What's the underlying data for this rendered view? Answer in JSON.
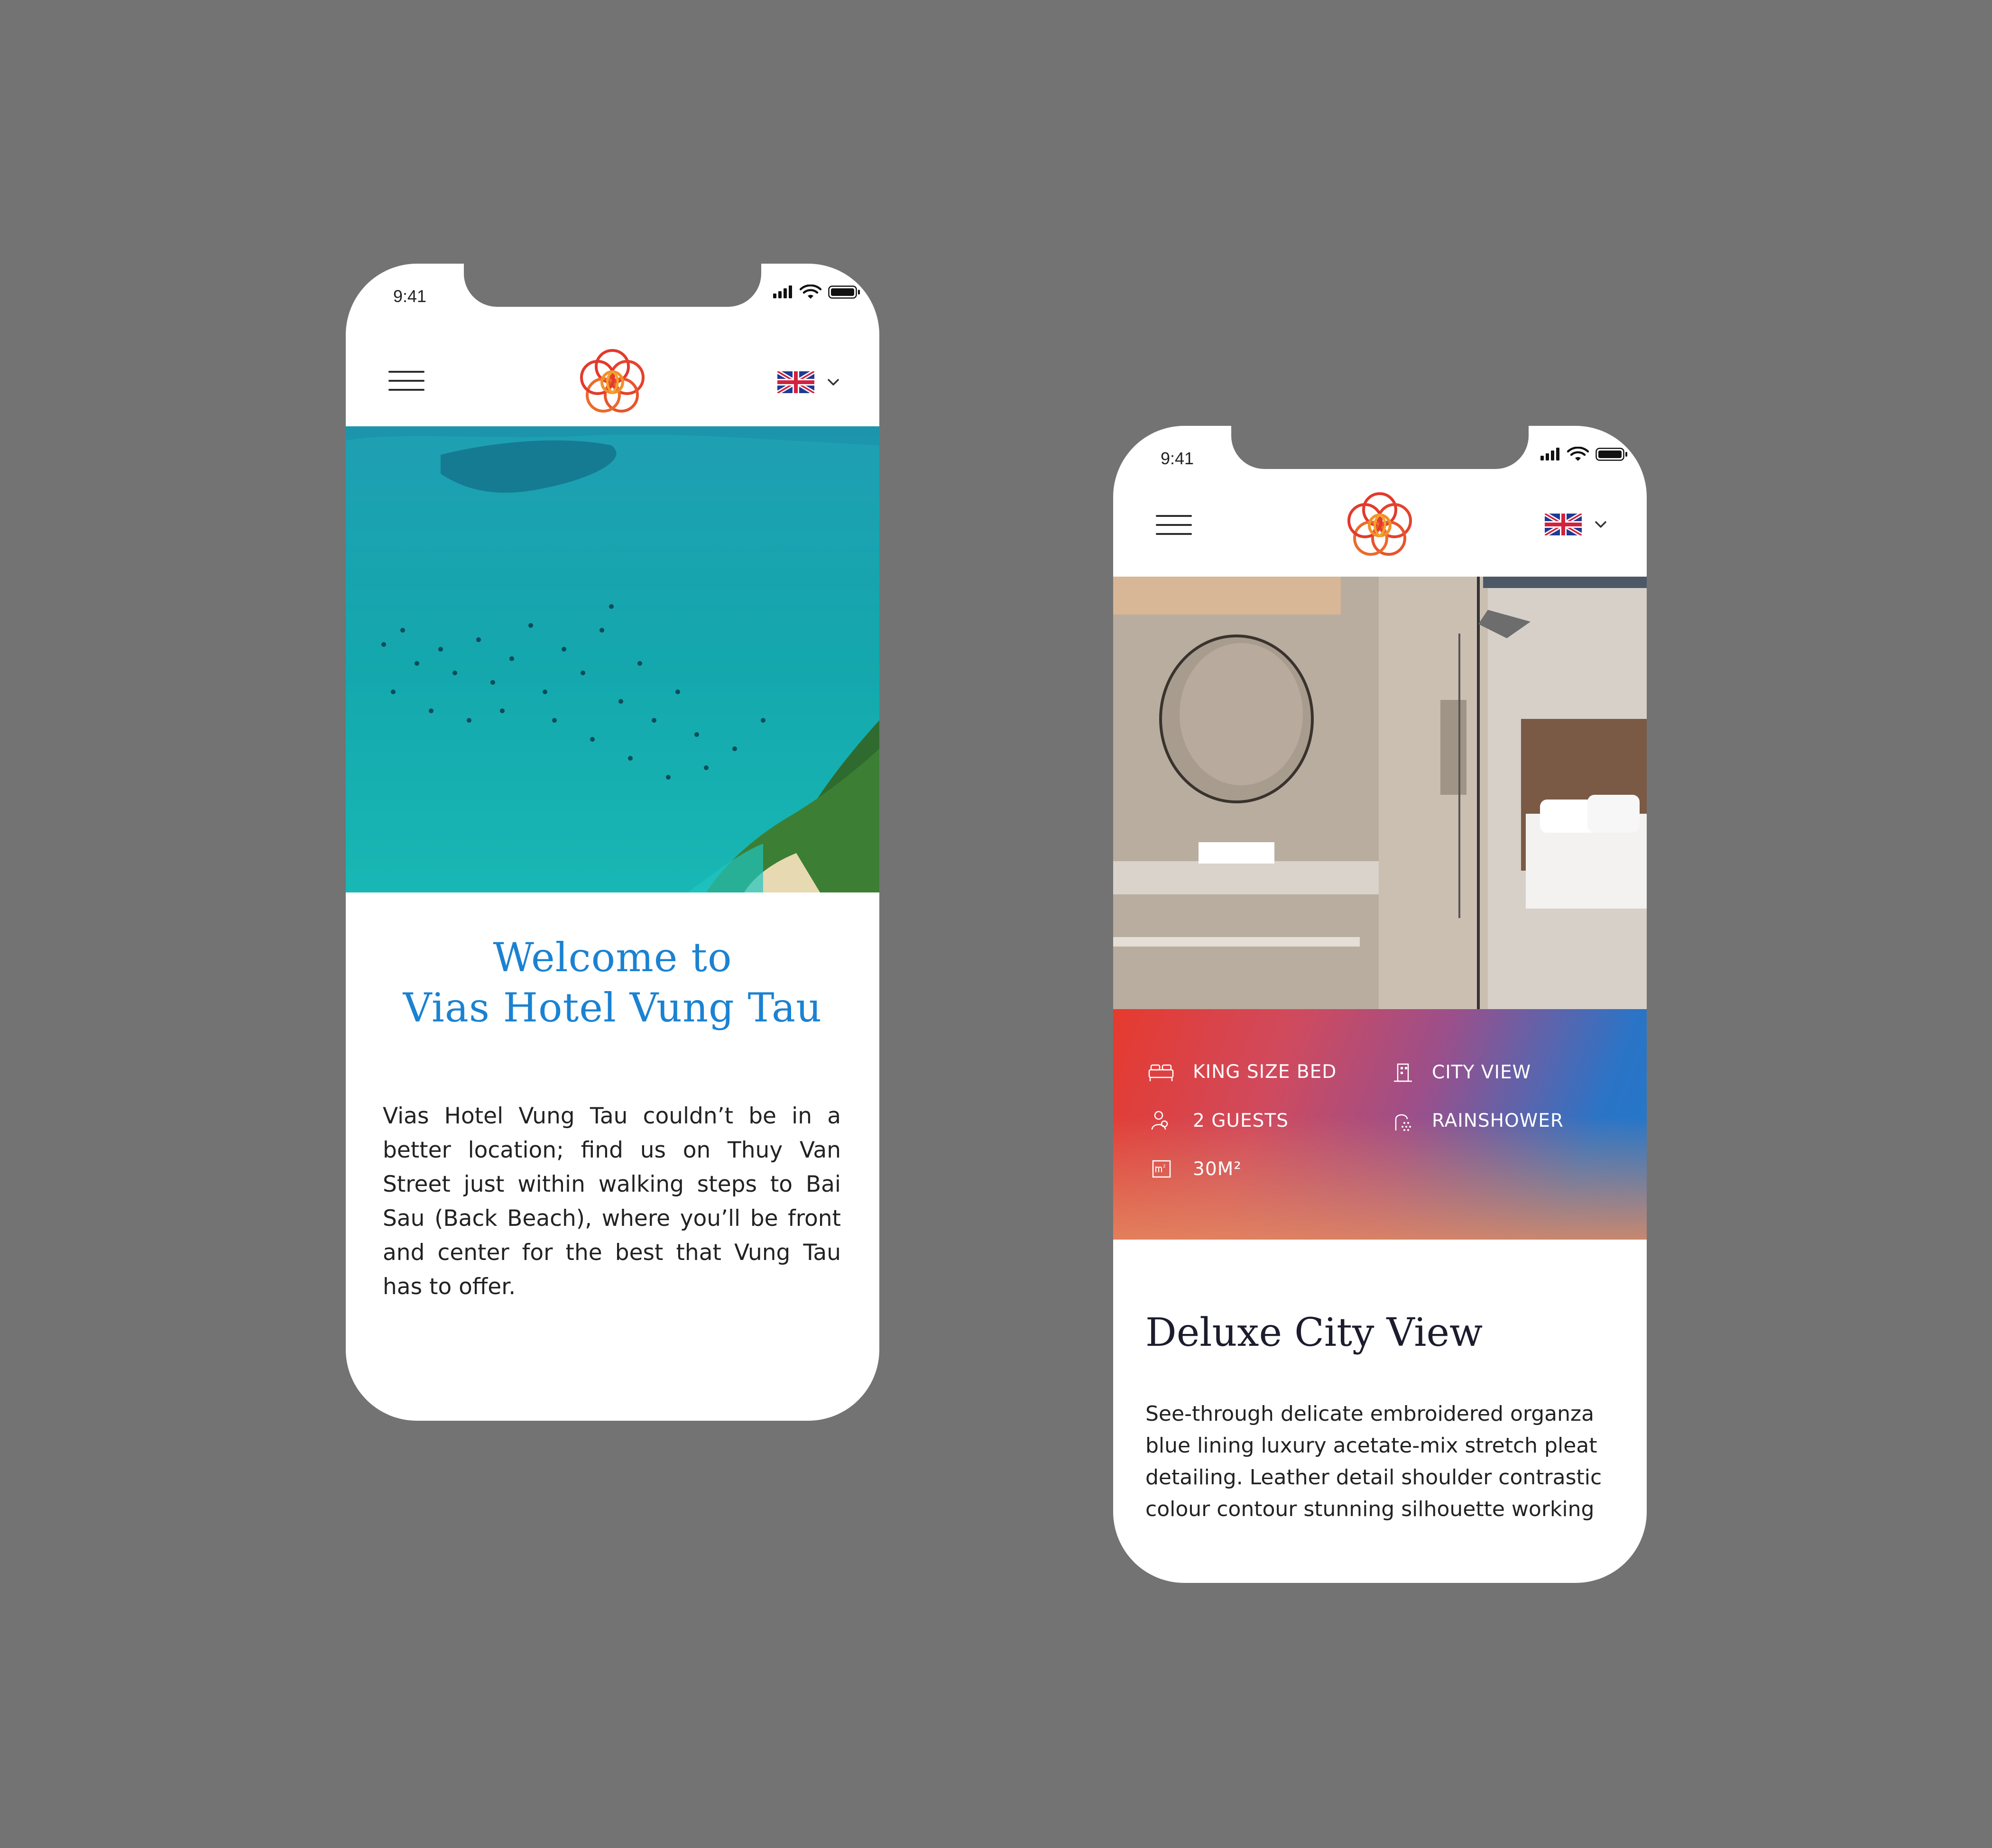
{
  "screens": [
    {
      "status_time": "9:41",
      "language": "English (UK)",
      "welcome_line1": "Welcome to",
      "welcome_line2": "Vias Hotel Vung Tau",
      "intro": "Vias Hotel Vung Tau couldn’t be in a better location; find us on Thuy Van Street just within walking steps to Bai Sau (Back Beach), where you’ll be front and center for the best that Vung Tau has to offer."
    },
    {
      "status_time": "9:41",
      "language": "English (UK)",
      "amenities": [
        {
          "label": "KING SIZE BED",
          "icon": "bed-icon"
        },
        {
          "label": "CITY VIEW",
          "icon": "building-icon"
        },
        {
          "label": "2 GUESTS",
          "icon": "guests-icon"
        },
        {
          "label": "RAINSHOWER",
          "icon": "shower-icon"
        },
        {
          "label": "30M²",
          "icon": "area-icon"
        }
      ],
      "room_title": "Deluxe City View",
      "room_description": "See-through delicate embroidered organza blue lining luxury acetate-mix stretch pleat detailing. Leather detail shoulder contrastic colour contour stunning silhouette working"
    }
  ],
  "colors": {
    "background": "#737373",
    "accent_blue": "#1b82d2",
    "logo_red": "#e23a2c",
    "logo_orange": "#f0902a"
  }
}
